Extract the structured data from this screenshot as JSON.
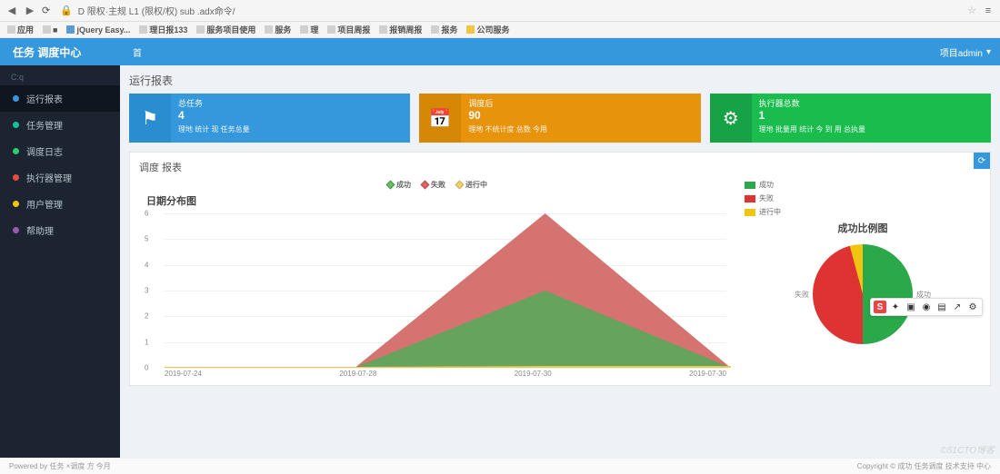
{
  "browser": {
    "url": "D 限权·主规 L1 (限权/权) sub .adx命令/",
    "bookmarks": [
      "应用",
      "■",
      "jQuery Easy...",
      "理日报133",
      "服务项目使用",
      "服务",
      "理",
      "项目周报",
      "报销周报",
      "报务",
      "公司服务"
    ]
  },
  "header": {
    "logo": "任务 调度中心",
    "nav": "首",
    "user": "项目admin",
    "caret": "▾"
  },
  "sidebar": {
    "search": "C:q",
    "items": [
      "运行报表",
      "任务管理",
      "调度日志",
      "执行器管理",
      "用户管理",
      "帮助理"
    ]
  },
  "content": {
    "title1": "运行报表",
    "stats": [
      {
        "label": "总任务",
        "num": "4",
        "desc": "理地 统计 现 任务总量"
      },
      {
        "label": "调度后",
        "num": "90",
        "desc": "理地 不统计度 总数 今用"
      },
      {
        "label": "执行器总数",
        "num": "1",
        "desc": "理地 批量用 统计 今 到 用 总执量"
      }
    ],
    "title2": "调度 报表",
    "lineTitle": "日期分布图",
    "lineLegend": [
      "成功",
      "失败",
      "进行中"
    ],
    "pieTitle": "成功比例图",
    "pieLegend": [
      "成功",
      "失败",
      "进行中"
    ],
    "pieLabels": {
      "left": "失败",
      "right": "成功"
    },
    "corner": "⟳"
  },
  "footer": {
    "left": "Powered by 任务 ×调度 方 今月",
    "right": "Copyright © 成功 任务调度 技术支持 中心"
  },
  "watermark": "©51CTO博客",
  "chart_data": [
    {
      "type": "area",
      "title": "日期分布图",
      "x": [
        "2019-07-24",
        "2019-07-28",
        "2019-07-30",
        "2019-07-30"
      ],
      "series": [
        {
          "name": "成功",
          "values": [
            0,
            0,
            3,
            0
          ]
        },
        {
          "name": "失败",
          "values": [
            0,
            0,
            6,
            0
          ]
        },
        {
          "name": "进行中",
          "values": [
            0,
            0,
            0,
            0
          ]
        }
      ],
      "ylim": [
        0,
        6
      ],
      "yticks": [
        0,
        1,
        2,
        3,
        4,
        5,
        6
      ]
    },
    {
      "type": "pie",
      "title": "成功比例图",
      "categories": [
        "成功",
        "失败",
        "进行中"
      ],
      "values": [
        50,
        46,
        4
      ]
    }
  ]
}
